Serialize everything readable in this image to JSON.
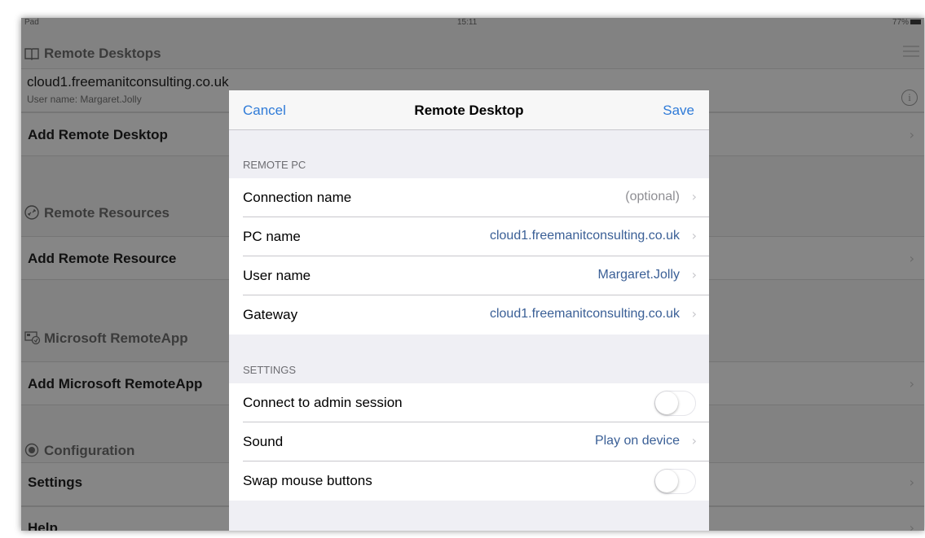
{
  "status": {
    "device": "Pad",
    "time": "15:11",
    "battery": "77%"
  },
  "sidebar": {
    "remote_desktops": {
      "title": "Remote Desktops",
      "host": "cloud1.freemanitconsulting.co.uk",
      "username": "User name: Margaret.Jolly",
      "add_label": "Add Remote Desktop"
    },
    "remote_resources": {
      "title": "Remote Resources",
      "add_label": "Add Remote Resource"
    },
    "remoteapp": {
      "title": "Microsoft RemoteApp",
      "add_label": "Add Microsoft RemoteApp"
    },
    "configuration": {
      "title": "Configuration",
      "items": [
        "Settings",
        "Help"
      ]
    }
  },
  "modal": {
    "cancel": "Cancel",
    "title": "Remote Desktop",
    "save": "Save",
    "remote_pc": {
      "header": "REMOTE PC",
      "connection_name": {
        "label": "Connection name",
        "value": "(optional)"
      },
      "pc_name": {
        "label": "PC name",
        "value": "cloud1.freemanitconsulting.co.uk"
      },
      "user_name": {
        "label": "User name",
        "value": "Margaret.Jolly"
      },
      "gateway": {
        "label": "Gateway",
        "value": "cloud1.freemanitconsulting.co.uk"
      }
    },
    "settings": {
      "header": "SETTINGS",
      "admin_session": {
        "label": "Connect to admin session",
        "enabled": false
      },
      "sound": {
        "label": "Sound",
        "value": "Play on device"
      },
      "swap_mouse": {
        "label": "Swap mouse buttons",
        "enabled": false
      }
    }
  },
  "colors": {
    "accent": "#2f7bd8",
    "value_text": "#3a5f96",
    "dim_overlay": "#828282"
  }
}
